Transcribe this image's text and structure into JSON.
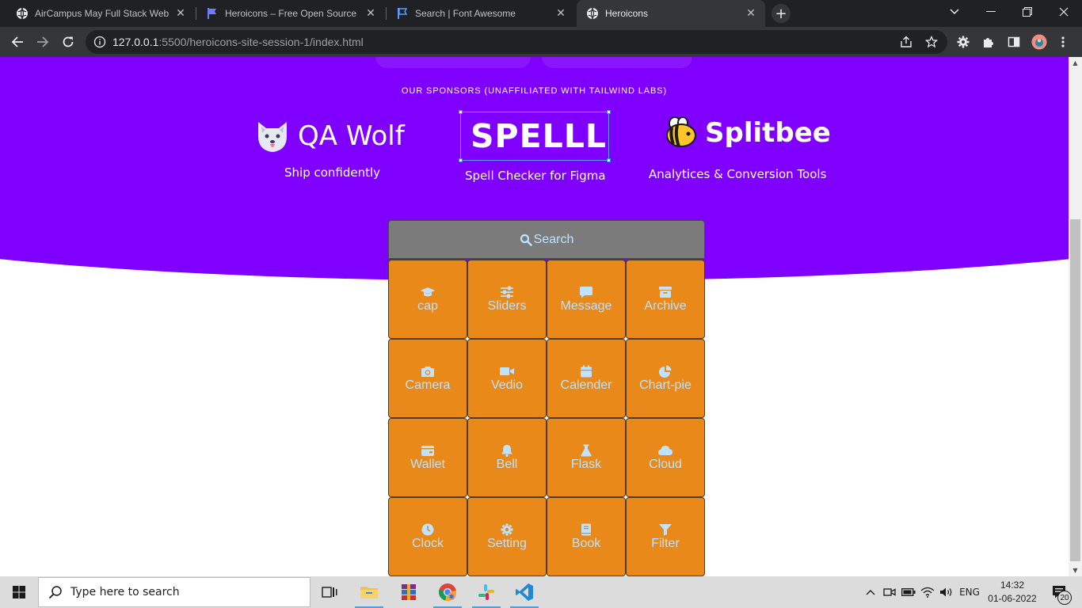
{
  "browser": {
    "tabs": [
      {
        "title": "AirCampus May Full Stack Web D",
        "icon": "globe-icon",
        "active": false
      },
      {
        "title": "Heroicons – Free Open Source SV",
        "icon": "flag-icon",
        "active": false
      },
      {
        "title": "Search | Font Awesome",
        "icon": "flag-outline-icon",
        "active": false
      },
      {
        "title": "Heroicons",
        "icon": "globe-icon",
        "active": true
      }
    ],
    "url_host": "127.0.0.1",
    "url_path": ":5500/heroicons-site-session-1/index.html"
  },
  "page": {
    "sponsors_heading": "OUR SPONSORS (UNAFFILIATED WITH TAILWIND LABS)",
    "sponsors": [
      {
        "name": "QA Wolf",
        "tagline": "Ship confidently",
        "icon": "wolf-icon"
      },
      {
        "name": "SPELLL",
        "tagline": "Spell Checker for Figma",
        "icon": ""
      },
      {
        "name": "Splitbee",
        "tagline": "Analytices & Conversion Tools",
        "icon": "bee-icon"
      }
    ],
    "search_label": "Search",
    "icons": [
      {
        "label": "cap",
        "icon": "graduation-cap-icon"
      },
      {
        "label": "Sliders",
        "icon": "sliders-icon"
      },
      {
        "label": "Message",
        "icon": "message-icon"
      },
      {
        "label": "Archive",
        "icon": "archive-icon"
      },
      {
        "label": "Camera",
        "icon": "camera-icon"
      },
      {
        "label": "Vedio",
        "icon": "video-icon"
      },
      {
        "label": "Calender",
        "icon": "calendar-icon"
      },
      {
        "label": "Chart-pie",
        "icon": "chart-pie-icon"
      },
      {
        "label": "Wallet",
        "icon": "wallet-icon"
      },
      {
        "label": "Bell",
        "icon": "bell-icon"
      },
      {
        "label": "Flask",
        "icon": "flask-icon"
      },
      {
        "label": "Cloud",
        "icon": "cloud-icon"
      },
      {
        "label": "Clock",
        "icon": "clock-icon"
      },
      {
        "label": "Setting",
        "icon": "gear-icon"
      },
      {
        "label": "Book",
        "icon": "book-icon"
      },
      {
        "label": "Filter",
        "icon": "filter-icon"
      }
    ]
  },
  "taskbar": {
    "search_placeholder": "Type here to search",
    "language": "ENG",
    "time": "14:32",
    "date": "01-06-2022",
    "notifications": "20"
  },
  "colors": {
    "hero": "#8000ff",
    "tile": "#e8891a",
    "icon_tint": "#bfe3ff"
  }
}
